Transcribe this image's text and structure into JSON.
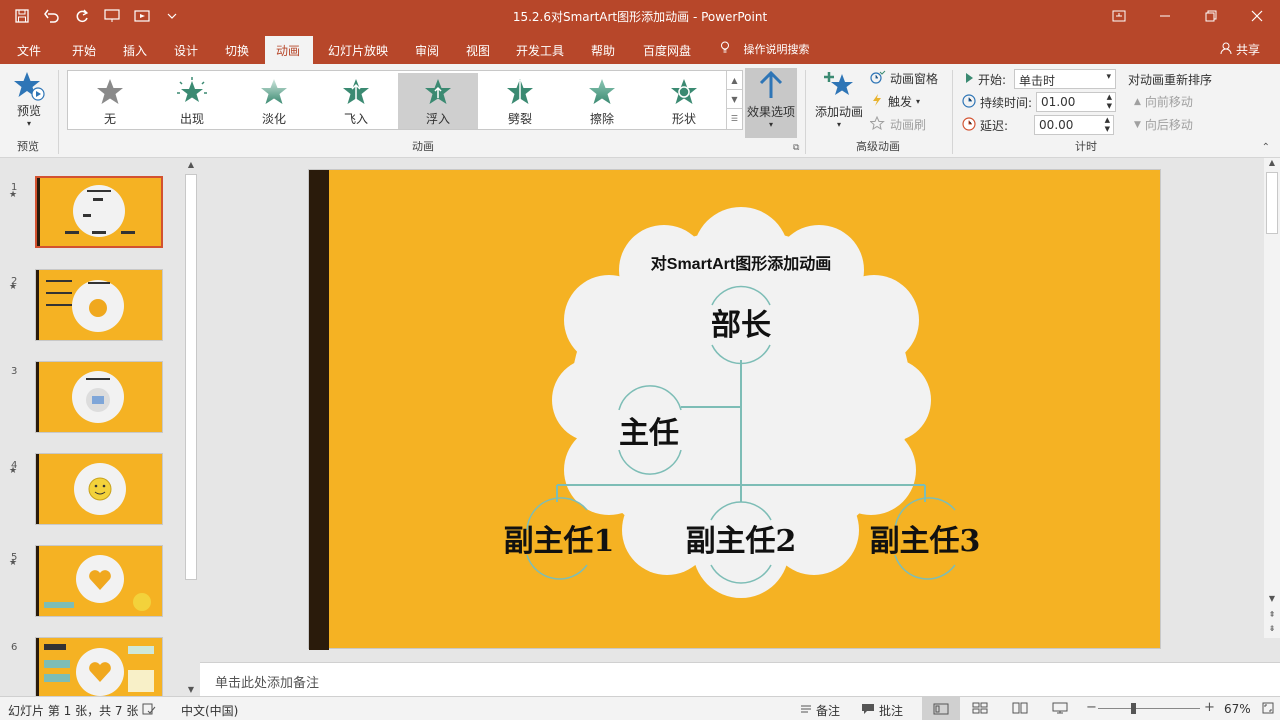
{
  "window": {
    "title": "15.2.6对SmartArt图形添加动画  -  PowerPoint"
  },
  "tabs": [
    {
      "label": "文件"
    },
    {
      "label": "开始"
    },
    {
      "label": "插入"
    },
    {
      "label": "设计"
    },
    {
      "label": "切换"
    },
    {
      "label": "动画"
    },
    {
      "label": "幻灯片放映"
    },
    {
      "label": "审阅"
    },
    {
      "label": "视图"
    },
    {
      "label": "开发工具"
    },
    {
      "label": "帮助"
    },
    {
      "label": "百度网盘"
    }
  ],
  "tell_me": "操作说明搜索",
  "share": "共享",
  "ribbon": {
    "preview": {
      "label": "预览",
      "group": "预览"
    },
    "animations": {
      "group": "动画",
      "items": [
        {
          "label": "无",
          "color": "#8a8a8a"
        },
        {
          "label": "出现",
          "color": "#3b8a72"
        },
        {
          "label": "淡化",
          "color": "#6ab09a"
        },
        {
          "label": "飞入",
          "color": "#3b8a72"
        },
        {
          "label": "浮入",
          "color": "#3b8a72"
        },
        {
          "label": "劈裂",
          "color": "#3b8a72"
        },
        {
          "label": "擦除",
          "color": "#5aa88f"
        },
        {
          "label": "形状",
          "color": "#3b8a72"
        }
      ],
      "selected": "浮入",
      "effect_options": "效果选项"
    },
    "advanced": {
      "group": "高级动画",
      "add_animation": "添加动画",
      "pane": "动画窗格",
      "trigger": "触发",
      "painter": "动画刷"
    },
    "timing": {
      "group": "计时",
      "start_label": "开始:",
      "start_value": "单击时",
      "duration_label": "持续时间:",
      "duration_value": "01.00",
      "delay_label": "延迟:",
      "delay_value": "00.00",
      "reorder_title": "对动画重新排序",
      "move_earlier": "向前移动",
      "move_later": "向后移动"
    }
  },
  "slides_pane": {
    "numbers": [
      "1",
      "2",
      "3",
      "4",
      "5",
      "6"
    ],
    "active": "1"
  },
  "slide": {
    "title": "对SmartArt图形添加动画",
    "nodes": {
      "top": "部长",
      "mid": "主任",
      "bottom_left": "副主任1",
      "bottom_center": "副主任2",
      "bottom_right": "副主任3"
    },
    "bg_color": "#f5b223",
    "cloud_color": "#f2f2f2",
    "line_color": "#7dbdb6"
  },
  "notes_placeholder": "单击此处添加备注",
  "status": {
    "slide_info": "幻灯片 第 1 张，共 7 张",
    "language": "中文(中国)",
    "notes": "备注",
    "comments": "批注",
    "zoom": "67%"
  },
  "theme": {
    "accent": "#b7472a"
  }
}
